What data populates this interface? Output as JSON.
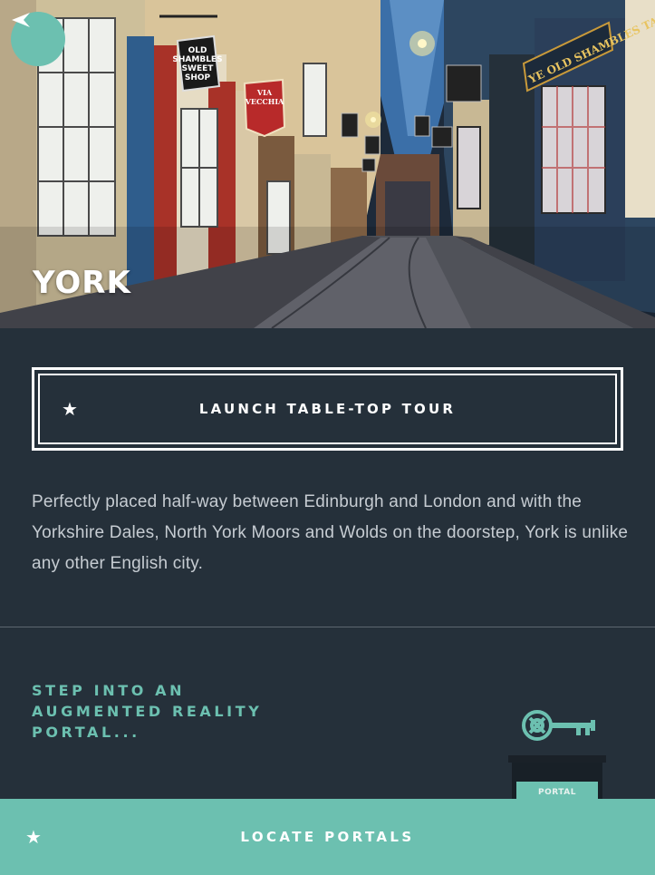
{
  "header": {
    "back_icon": "back-arrow-icon",
    "city_name": "YORK",
    "hero_signs": {
      "sweet_shop": [
        "OLD",
        "SHAMBLES",
        "SWEET",
        "SHOP"
      ],
      "via_vecchia": [
        "VIA",
        "VECCHIA"
      ],
      "tavern": "YE OLD SHAMBLES TAV"
    }
  },
  "launch_button": {
    "icon": "star-icon",
    "label": "LAUNCH TABLE-TOP TOUR"
  },
  "description": "Perfectly placed half-way between Edinburgh and London and with the Yorkshire Dales, North York Moors and Wolds on the doorstep, York is unlike any other English city.",
  "portal_promo": {
    "heading": "STEP INTO AN AUGMENTED REALITY PORTAL...",
    "key_icon": "key-icon",
    "portal_label": "PORTAL"
  },
  "bottom_bar": {
    "icon": "star-icon",
    "label": "LOCATE PORTALS"
  },
  "colors": {
    "background": "#25303a",
    "accent": "#6cc0b0",
    "text": "#ffffff",
    "body_text": "#c6ccd2"
  }
}
